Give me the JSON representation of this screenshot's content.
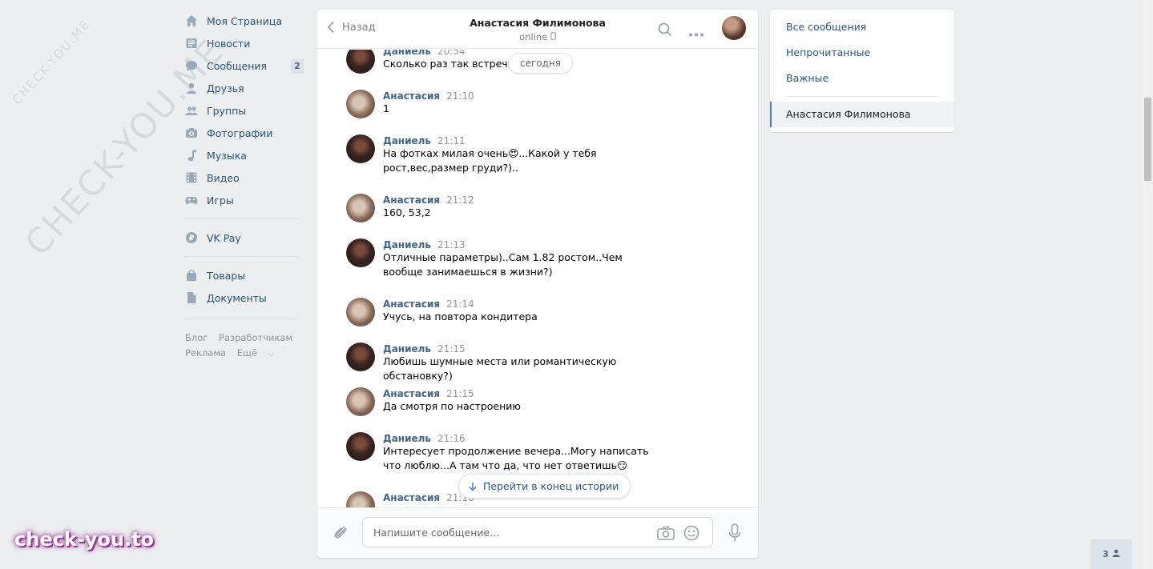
{
  "watermark": {
    "small": "CHECK-YOU.ME",
    "large": "CHECK-YOU.ME",
    "logo": "check-you.to"
  },
  "nav": {
    "items": [
      {
        "label": "Моя Страница",
        "icon": "home-icon"
      },
      {
        "label": "Новости",
        "icon": "news-icon"
      },
      {
        "label": "Сообщения",
        "icon": "messages-icon",
        "badge": "2"
      },
      {
        "label": "Друзья",
        "icon": "friends-icon"
      },
      {
        "label": "Группы",
        "icon": "groups-icon"
      },
      {
        "label": "Фотографии",
        "icon": "camera-icon"
      },
      {
        "label": "Музыка",
        "icon": "music-icon"
      },
      {
        "label": "Видео",
        "icon": "video-icon"
      },
      {
        "label": "Игры",
        "icon": "gamepad-icon"
      }
    ],
    "vkpay": "VK Pay",
    "goods": "Товары",
    "docs": "Документы",
    "footer": {
      "blog": "Блог",
      "dev": "Разработчикам",
      "ads": "Реклама",
      "more": "Ещё"
    }
  },
  "chat": {
    "back": "Назад",
    "peer_name": "Анастасия Филимонова",
    "peer_status": "online",
    "day_label": "сегодня",
    "jump_label": "Перейти в конец истории",
    "placeholder": "Напишите сообщение...",
    "messages": [
      {
        "author": "Даниель",
        "time": "20:54",
        "text": "Сколько раз так встречал"
      },
      {
        "author": "Анастасия",
        "time": "21:10",
        "text": "1"
      },
      {
        "author": "Даниель",
        "time": "21:11",
        "text": "На фотках милая очень😍...Какой у тебя рост,вес,размер груди?).."
      },
      {
        "author": "Анастасия",
        "time": "21:12",
        "text": "160, 53,2"
      },
      {
        "author": "Даниель",
        "time": "21:13",
        "text": "Отличные параметры)..Сам 1.82 ростом..Чем вообще занимаешься в жизни?)"
      },
      {
        "author": "Анастасия",
        "time": "21:14",
        "text": "Учусь, на повтора кондитера"
      },
      {
        "author": "Даниель",
        "time": "21:15",
        "text": "Любишь шумные места или романтическую обстановку?)"
      },
      {
        "author": "Анастасия",
        "time": "21:15",
        "text": "Да смотря по настроению"
      },
      {
        "author": "Даниель",
        "time": "21:16",
        "text": "Интересует продолжение вечера...Могу написать что люблю...А там что да, что нет ответишь😏"
      },
      {
        "author": "Анастасия",
        "time": "21:16",
        "text": ""
      }
    ]
  },
  "right": {
    "all": "Все сообщения",
    "unread": "Непрочитанные",
    "important": "Важные",
    "active": "Анастасия Филимонова"
  },
  "friends_count": "3"
}
